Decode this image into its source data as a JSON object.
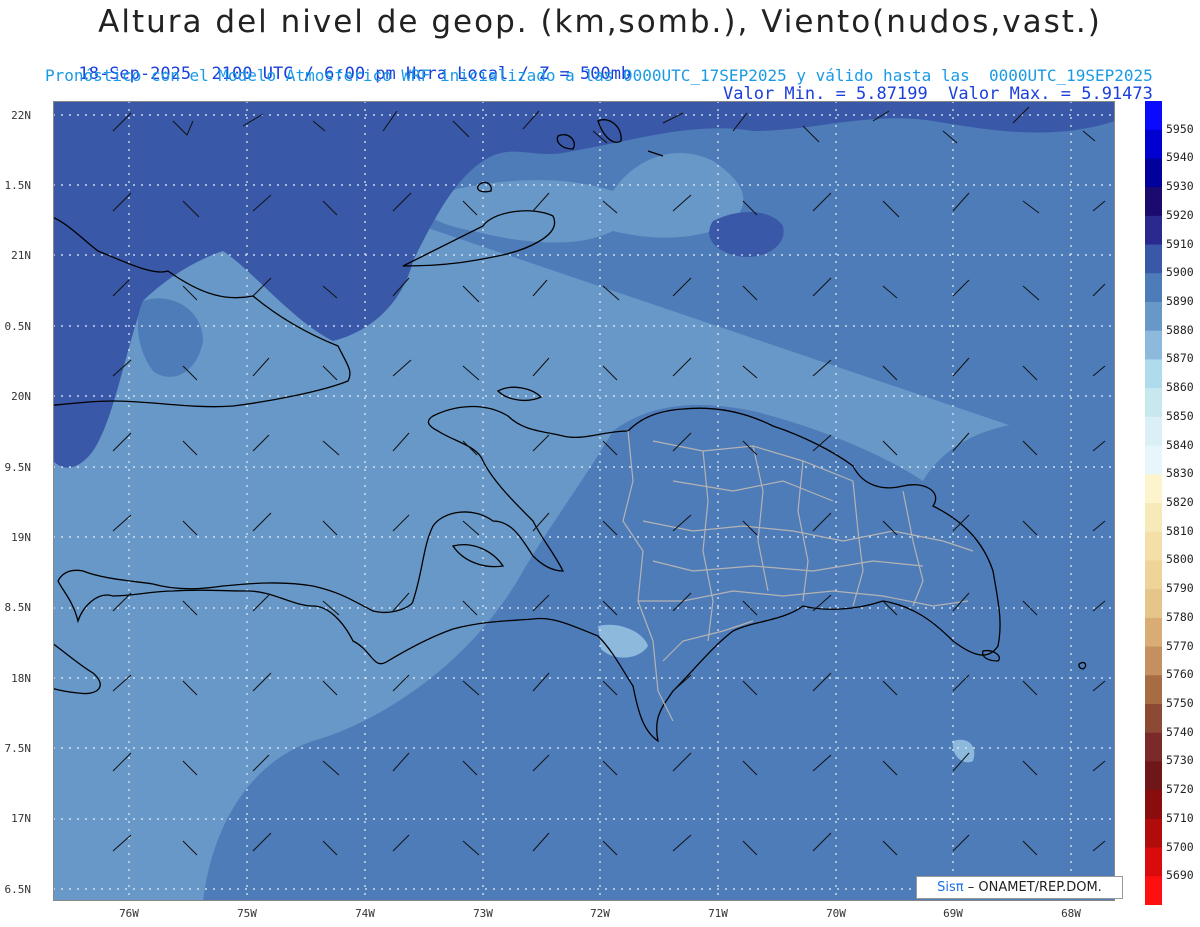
{
  "header": {
    "title": "Altura del nivel de geop. (km,somb.), Viento(nudos,vast.)",
    "subtitle_left": "18-Sep-2025  2100 UTC / 6:00 pm Hora Local / Z = 500mb",
    "subtitle_right": "Valor Min. = 5.87199  Valor Max. = 5.91473",
    "subtitle2": "Pronóstico con el Modelo Atmosferico WRF inicializado a las 0000UTC_17SEP2025 y válido hasta las  0000UTC_19SEP2025"
  },
  "map": {
    "lat_labels": [
      "22N",
      "1.5N",
      "21N",
      "0.5N",
      "20N",
      "9.5N",
      "19N",
      "8.5N",
      "18N",
      "7.5N",
      "17N",
      "6.5N"
    ],
    "lon_labels": [
      "76W",
      "75W",
      "74W",
      "73W",
      "72W",
      "71W",
      "70W",
      "69W",
      "68W"
    ],
    "grid": true,
    "colors": {
      "c5900": "#3a58a8",
      "c5890": "#4e7cb9",
      "c5880": "#6898c7",
      "c5870": "#8cb9dc",
      "land_border": "#000000",
      "admin_border": "#b0b0b0"
    }
  },
  "colorbar": {
    "levels": [
      "5950",
      "5940",
      "5930",
      "5920",
      "5910",
      "5900",
      "5890",
      "5880",
      "5870",
      "5860",
      "5850",
      "5840",
      "5830",
      "5820",
      "5810",
      "5800",
      "5790",
      "5780",
      "5770",
      "5760",
      "5750",
      "5740",
      "5730",
      "5720",
      "5710",
      "5700",
      "5690"
    ],
    "colors": [
      "#0a0aff",
      "#0000d0",
      "#00009a",
      "#1c0a6e",
      "#2a2a8e",
      "#3a58a8",
      "#4e7cb9",
      "#6898c7",
      "#8cb9dc",
      "#aedcec",
      "#c8e8f0",
      "#dbf0f6",
      "#e6f6fa",
      "#fdf3cc",
      "#f8e9b8",
      "#f4dfa8",
      "#efd49a",
      "#e6c58a",
      "#d8ac74",
      "#c49060",
      "#a86c44",
      "#8c4a34",
      "#7a2a28",
      "#6e1618",
      "#8a0c0c",
      "#b00c0c",
      "#d80c0c",
      "#ff1010"
    ]
  },
  "credit": {
    "brand": "Sisπ",
    "text": "– ONAMET/REP.DOM."
  }
}
